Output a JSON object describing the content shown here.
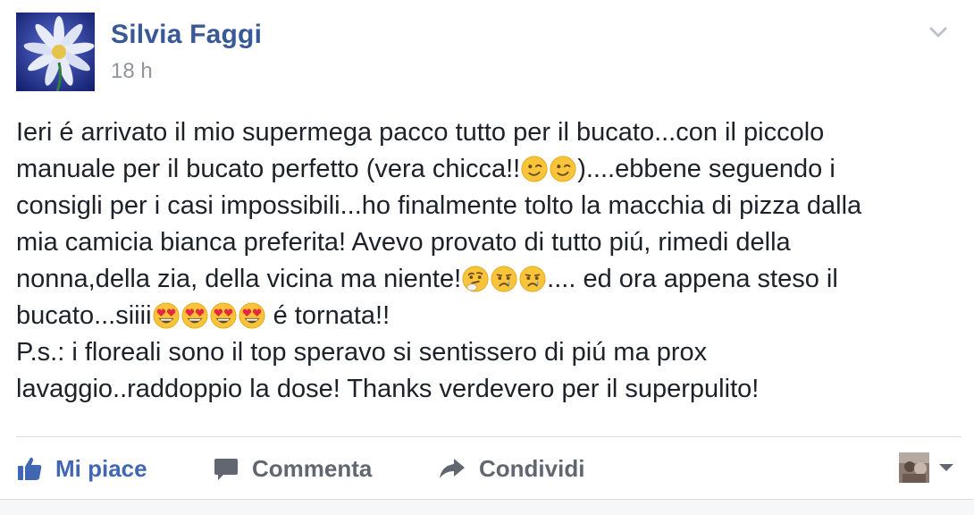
{
  "post": {
    "author": "Silvia Faggi",
    "timestamp": "18 h",
    "lines": [
      [
        {
          "t": "text",
          "v": "Ieri é arrivato il mio supermega pacco tutto per il bucato...con il piccolo"
        }
      ],
      [
        {
          "t": "text",
          "v": "manuale per il bucato perfetto (vera chicca!!"
        },
        {
          "t": "emoji",
          "v": "wink"
        },
        {
          "t": "emoji",
          "v": "wink"
        },
        {
          "t": "text",
          "v": ")....ebbene seguendo i"
        }
      ],
      [
        {
          "t": "text",
          "v": "consigli per i casi impossibili...ho finalmente tolto la macchia di pizza dalla"
        }
      ],
      [
        {
          "t": "text",
          "v": "mia camicia bianca preferita! Avevo provato di tutto piú, rimedi della"
        }
      ],
      [
        {
          "t": "text",
          "v": "nonna,della zia, della vicina ma niente!"
        },
        {
          "t": "emoji",
          "v": "thinking"
        },
        {
          "t": "emoji",
          "v": "sad-tear"
        },
        {
          "t": "emoji",
          "v": "sad-tear"
        },
        {
          "t": "text",
          "v": ".... ed ora appena steso il"
        }
      ],
      [
        {
          "t": "text",
          "v": "bucato...siiii"
        },
        {
          "t": "emoji",
          "v": "heart-eyes"
        },
        {
          "t": "emoji",
          "v": "heart-eyes"
        },
        {
          "t": "emoji",
          "v": "heart-eyes"
        },
        {
          "t": "emoji",
          "v": "heart-eyes"
        },
        {
          "t": "text",
          "v": " é tornata!!"
        }
      ],
      [
        {
          "t": "text",
          "v": "P.s.: i floreali sono il top speravo si sentissero di piú ma prox"
        }
      ],
      [
        {
          "t": "text",
          "v": "lavaggio..raddoppio la dose! Thanks verdevero per il superpulito!"
        }
      ]
    ]
  },
  "actions": {
    "like": "Mi piace",
    "comment": "Commenta",
    "share": "Condividi"
  },
  "icons": {
    "avatar": "daisy-photo-icon",
    "menu": "chevron-down-icon",
    "like": "thumbs-up-icon",
    "comment": "comment-bubble-icon",
    "share": "share-arrow-icon",
    "viewer": "viewer-avatar-icon",
    "viewer_menu": "caret-down-icon"
  },
  "colors": {
    "author": "#385898",
    "like_active": "#4267b2",
    "action": "#606770",
    "timestamp": "#90949c",
    "text": "#1d2129"
  }
}
